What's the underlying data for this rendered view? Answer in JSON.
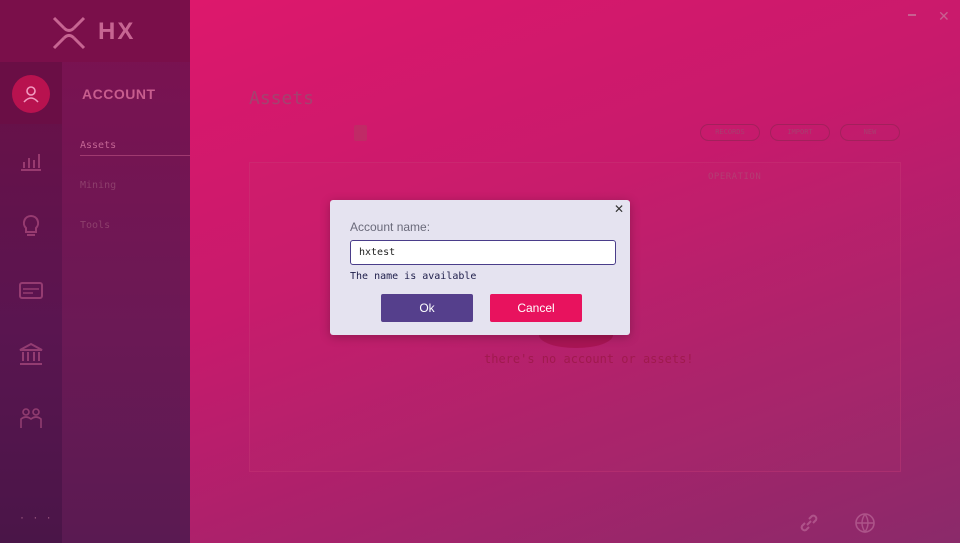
{
  "brand": {
    "name": "HX"
  },
  "sidebar": {
    "section_title": "ACCOUNT",
    "items": [
      {
        "label": "Assets",
        "active": true
      },
      {
        "label": "Mining"
      },
      {
        "label": "Tools"
      }
    ],
    "more": "· · ·",
    "rail_icons": [
      "user-icon",
      "chart-icon",
      "bulb-icon",
      "card-icon",
      "bank-icon",
      "people-icon"
    ]
  },
  "main": {
    "title": "Assets",
    "buttons": [
      "RECORDS",
      "IMPORT",
      "NEW"
    ],
    "column_header": "OPERATION",
    "empty_message": "there's no account or assets!"
  },
  "window": {
    "minimize": "",
    "close": "✕"
  },
  "footer": {
    "lang_label": ""
  },
  "dialog": {
    "label": "Account name:",
    "input_value": "hxtest",
    "status": "The name is available",
    "ok_label": "Ok",
    "cancel_label": "Cancel",
    "close": "✕"
  },
  "colors": {
    "accent": "#e8125e",
    "ok_button": "#553f8c",
    "dialog_bg": "#e5e3f0"
  }
}
